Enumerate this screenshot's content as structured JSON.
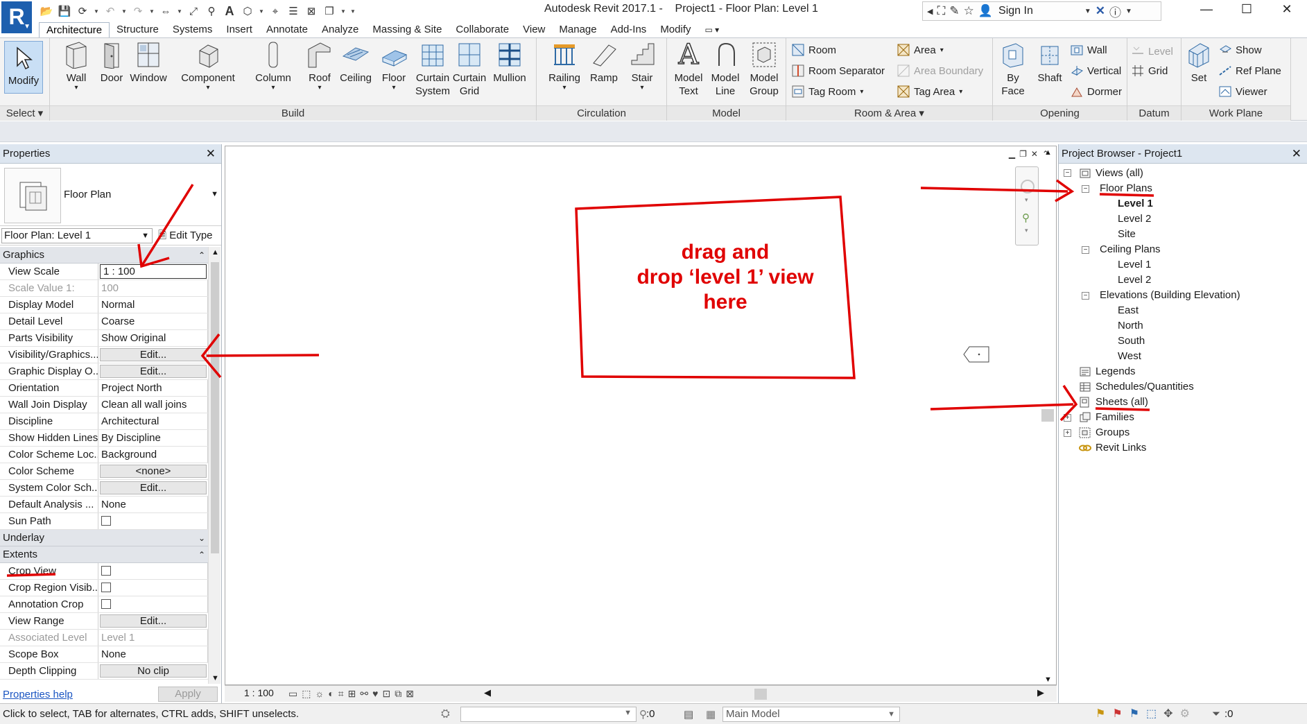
{
  "app": {
    "title": "Autodesk Revit 2017.1 -    Project1 - Floor Plan: Level 1",
    "logo": "R",
    "sign_in": "Sign In"
  },
  "ribbon": {
    "tabs": [
      "Architecture",
      "Structure",
      "Systems",
      "Insert",
      "Annotate",
      "Analyze",
      "Massing & Site",
      "Collaborate",
      "View",
      "Manage",
      "Add-Ins",
      "Modify"
    ],
    "active_tab": "Architecture",
    "select": {
      "modify": "Modify",
      "title": "Select"
    },
    "build": {
      "title": "Build",
      "wall": "Wall",
      "door": "Door",
      "window": "Window",
      "component": "Component",
      "column": "Column",
      "roof": "Roof",
      "ceiling": "Ceiling",
      "floor": "Floor",
      "curtain_system": [
        "Curtain",
        "System"
      ],
      "curtain_grid": [
        "Curtain",
        "Grid"
      ],
      "mullion": "Mullion"
    },
    "circulation": {
      "title": "Circulation",
      "railing": "Railing",
      "ramp": "Ramp",
      "stair": "Stair"
    },
    "model": {
      "title": "Model",
      "model_text": [
        "Model",
        "Text"
      ],
      "model_line": [
        "Model",
        "Line"
      ],
      "model_group": [
        "Model",
        "Group"
      ]
    },
    "room_area": {
      "title": "Room & Area",
      "room": "Room",
      "room_separator": "Room  Separator",
      "tag_room": "Tag  Room",
      "area": "Area",
      "area_boundary": "Area  Boundary",
      "tag_area": "Tag  Area"
    },
    "opening": {
      "title": "Opening",
      "by_face": [
        "By",
        "Face"
      ],
      "shaft": "Shaft",
      "wall": "Wall",
      "vertical": "Vertical",
      "dormer": "Dormer"
    },
    "datum": {
      "title": "Datum",
      "level": "Level",
      "grid": "Grid"
    },
    "work_plane": {
      "title": "Work Plane",
      "set": "Set",
      "show": "Show",
      "ref_plane": "Ref  Plane",
      "viewer": "Viewer"
    }
  },
  "properties": {
    "title": "Properties",
    "type_name": "Floor Plan",
    "instance": "Floor Plan: Level 1",
    "edit_type": "Edit Type",
    "sections": {
      "graphics": "Graphics",
      "underlay": "Underlay",
      "extents": "Extents"
    },
    "graphics_rows": [
      {
        "key": "View Scale",
        "value": "1 : 100"
      },
      {
        "key": "Scale Value    1:",
        "value": "100"
      },
      {
        "key": "Display Model",
        "value": "Normal"
      },
      {
        "key": "Detail Level",
        "value": "Coarse"
      },
      {
        "key": "Parts Visibility",
        "value": "Show Original"
      },
      {
        "key": "Visibility/Graphics...",
        "value": "Edit..."
      },
      {
        "key": "Graphic Display O...",
        "value": "Edit..."
      },
      {
        "key": "Orientation",
        "value": "Project North"
      },
      {
        "key": "Wall Join Display",
        "value": "Clean all wall joins"
      },
      {
        "key": "Discipline",
        "value": "Architectural"
      },
      {
        "key": "Show Hidden Lines",
        "value": "By Discipline"
      },
      {
        "key": "Color Scheme Loc...",
        "value": "Background"
      },
      {
        "key": "Color Scheme",
        "value": "<none>"
      },
      {
        "key": "System Color Sch...",
        "value": "Edit..."
      },
      {
        "key": "Default Analysis ...",
        "value": "None"
      },
      {
        "key": "Sun Path",
        "value": ""
      }
    ],
    "extents_rows": [
      {
        "key": "Crop View",
        "value": ""
      },
      {
        "key": "Crop Region Visib...",
        "value": ""
      },
      {
        "key": "Annotation Crop",
        "value": ""
      },
      {
        "key": "View Range",
        "value": "Edit..."
      },
      {
        "key": "Associated Level",
        "value": "Level 1"
      },
      {
        "key": "Scope Box",
        "value": "None"
      },
      {
        "key": "Depth Clipping",
        "value": "No clip"
      }
    ],
    "help": "Properties help",
    "apply": "Apply"
  },
  "drawing": {
    "annotation_lines": [
      "drag and",
      "drop ‘level 1’ view",
      "here"
    ],
    "scale": "1 : 100"
  },
  "browser": {
    "title": "Project Browser - Project1",
    "views_all": "Views (all)",
    "floor_plans": "Floor Plans",
    "fp_items": [
      "Level 1",
      "Level 2",
      "Site"
    ],
    "ceiling_plans": "Ceiling Plans",
    "cp_items": [
      "Level 1",
      "Level 2"
    ],
    "elevations": "Elevations (Building Elevation)",
    "el_items": [
      "East",
      "North",
      "South",
      "West"
    ],
    "legends": "Legends",
    "schedules": "Schedules/Quantities",
    "sheets": "Sheets (all)",
    "families": "Families",
    "groups": "Groups",
    "revit_links": "Revit Links"
  },
  "status": {
    "hint": "Click to select, TAB for alternates, CTRL adds, SHIFT unselects.",
    "worksets_count": ":0",
    "model": "Main Model",
    "filter_count": ":0"
  },
  "colors": {
    "annotation": "#e00000",
    "active_tab_border": "#a9b7c8",
    "link": "#1a55c2"
  }
}
